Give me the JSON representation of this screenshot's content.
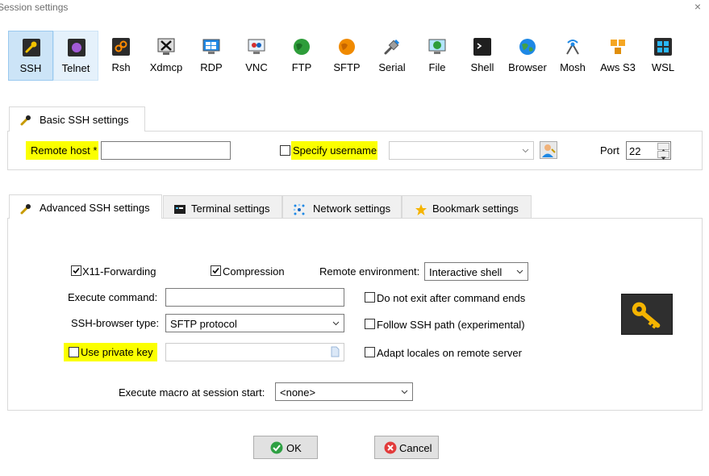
{
  "window": {
    "title": "Session settings",
    "close_glyph": "×"
  },
  "protocols": [
    {
      "label": "SSH",
      "icon": "ssh-wrench-icon",
      "state": "selected"
    },
    {
      "label": "Telnet",
      "icon": "telnet-icon",
      "state": "hover"
    },
    {
      "label": "Rsh",
      "icon": "rsh-icon",
      "state": ""
    },
    {
      "label": "Xdmcp",
      "icon": "xdmcp-icon",
      "state": ""
    },
    {
      "label": "RDP",
      "icon": "rdp-icon",
      "state": ""
    },
    {
      "label": "VNC",
      "icon": "vnc-icon",
      "state": ""
    },
    {
      "label": "FTP",
      "icon": "ftp-globe-icon",
      "state": ""
    },
    {
      "label": "SFTP",
      "icon": "sftp-globe-icon",
      "state": ""
    },
    {
      "label": "Serial",
      "icon": "serial-plug-icon",
      "state": ""
    },
    {
      "label": "File",
      "icon": "file-icon",
      "state": ""
    },
    {
      "label": "Shell",
      "icon": "shell-terminal-icon",
      "state": ""
    },
    {
      "label": "Browser",
      "icon": "browser-globe-icon",
      "state": ""
    },
    {
      "label": "Mosh",
      "icon": "mosh-antenna-icon",
      "state": ""
    },
    {
      "label": "Aws S3",
      "icon": "aws-s3-icon",
      "state": ""
    },
    {
      "label": "WSL",
      "icon": "wsl-windows-icon",
      "state": ""
    }
  ],
  "basic": {
    "tab_label": "Basic SSH settings",
    "remote_host_label": "Remote host *",
    "remote_host_value": "",
    "specify_username_label": "Specify username",
    "specify_username_checked": false,
    "username_value": "",
    "port_label": "Port",
    "port_value": "22"
  },
  "advanced_tabs": [
    {
      "label": "Advanced SSH settings",
      "icon": "wrench-icon",
      "active": true
    },
    {
      "label": "Terminal settings",
      "icon": "terminal-icon",
      "active": false
    },
    {
      "label": "Network settings",
      "icon": "network-icon",
      "active": false
    },
    {
      "label": "Bookmark settings",
      "icon": "star-icon",
      "active": false
    }
  ],
  "advanced": {
    "x11_label": "X11-Forwarding",
    "x11_checked": true,
    "compression_label": "Compression",
    "compression_checked": true,
    "remote_env_label": "Remote environment:",
    "remote_env_value": "Interactive shell",
    "execute_command_label": "Execute command:",
    "execute_command_value": "",
    "no_exit_label": "Do not exit after command ends",
    "no_exit_checked": false,
    "browser_type_label": "SSH-browser type:",
    "browser_type_value": "SFTP protocol",
    "follow_path_label": "Follow SSH path (experimental)",
    "follow_path_checked": false,
    "private_key_label": "Use private key",
    "private_key_checked": false,
    "private_key_value": "",
    "adapt_locales_label": "Adapt locales on remote server",
    "adapt_locales_checked": false,
    "macro_label": "Execute macro at session start:",
    "macro_value": "<none>"
  },
  "buttons": {
    "ok_label": "OK",
    "cancel_label": "Cancel"
  },
  "colors": {
    "highlight": "#fbff00",
    "selected_bg": "#cce4f7",
    "ok_green": "#2ea043",
    "cancel_red": "#e23b3b",
    "key_gold": "#f5b400"
  }
}
